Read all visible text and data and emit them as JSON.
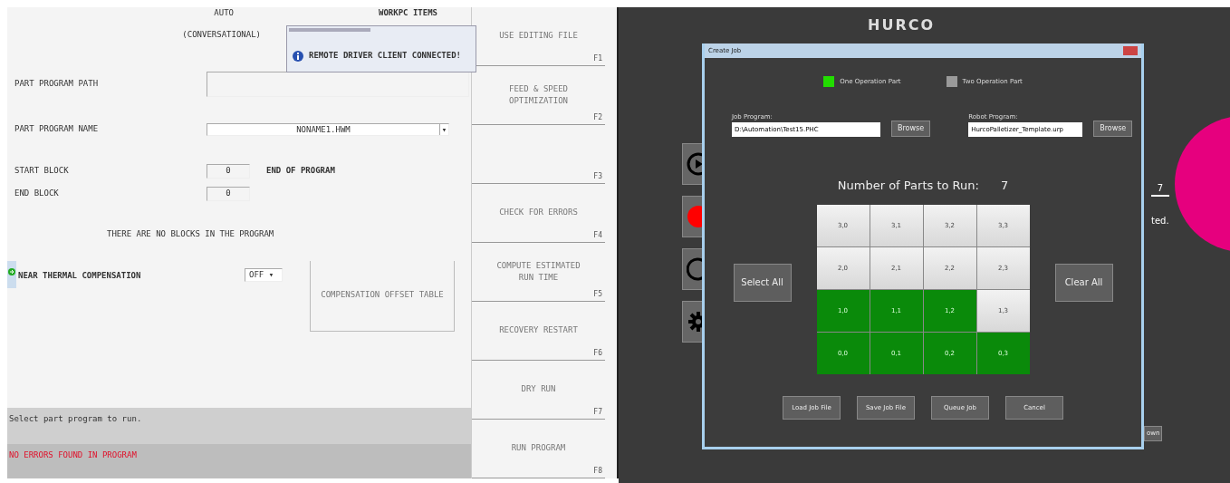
{
  "cnc_screen": {
    "mode": "AUTO",
    "mode_type": "(CONVERSATIONAL)",
    "header_right": "WORKPC ITEMS",
    "notification": {
      "message": "REMOTE DRIVER CLIENT CONNECTED!"
    },
    "fields": [
      {
        "kind": "text",
        "label": "PART PROGRAM PATH"
      },
      {
        "kind": "select",
        "label": "PART PROGRAM NAME",
        "value": "NONAME1.HWM",
        "arrow": "▾"
      }
    ],
    "start_block": {
      "label": "START BLOCK",
      "value": "0",
      "note": "END OF PROGRAM"
    },
    "end_block": {
      "label": "END BLOCK",
      "value": "0"
    },
    "blocks_message": "THERE ARE NO BLOCKS IN THE PROGRAM",
    "thermal": {
      "label": "NEAR THERMAL COMPENSATION",
      "value": "OFF",
      "arrow": "▾"
    },
    "offset_button": "COMPENSATION OFFSET TABLE",
    "softkeys": [
      {
        "label": "USE EDITING FILE",
        "key": "F1"
      },
      {
        "label": "FEED & SPEED OPTIMIZATION",
        "key": "F2"
      },
      {
        "key": "F3"
      },
      {
        "label": "CHECK FOR ERRORS",
        "key": "F4"
      },
      {
        "label": "COMPUTE ESTIMATED RUN TIME",
        "key": "F5"
      },
      {
        "label": "RECOVERY RESTART",
        "key": "F6"
      },
      {
        "label": "DRY RUN",
        "key": "F7"
      },
      {
        "label": "RUN PROGRAM",
        "key": "F8"
      }
    ],
    "prompt": "Select part program to run.",
    "error_line": "NO ERRORS FOUND IN PROGRAM"
  },
  "robot_app": {
    "logo": "HURCO",
    "count_field": "7",
    "status_fragment": "ted.",
    "button_fragment": "own",
    "dialog": {
      "title": "Create Job",
      "part_types": [
        {
          "label": "One Operation Part",
          "selected": true
        },
        {
          "label": "Two Operation Part",
          "selected": false
        }
      ],
      "job_program": {
        "label": "Job Program:",
        "value": "D:\\Automation\\Test15.PHC",
        "button": "Browse"
      },
      "robot_program": {
        "label": "Robot Program:",
        "value": "HurcoPalletizer_Template.urp",
        "button": "Browse"
      },
      "parts_label": "Number of Parts to Run:",
      "parts_count": "7",
      "select_all": "Select All",
      "clear_all": "Clear All",
      "cells": [
        {
          "label": "3,0",
          "selected": false
        },
        {
          "label": "3,1",
          "selected": false
        },
        {
          "label": "3,2",
          "selected": false
        },
        {
          "label": "3,3",
          "selected": false
        },
        {
          "label": "2,0",
          "selected": false
        },
        {
          "label": "2,1",
          "selected": false
        },
        {
          "label": "2,2",
          "selected": false
        },
        {
          "label": "2,3",
          "selected": false
        },
        {
          "label": "1,0",
          "selected": true
        },
        {
          "label": "1,1",
          "selected": true
        },
        {
          "label": "1,2",
          "selected": true
        },
        {
          "label": "1,3",
          "selected": false
        },
        {
          "label": "0,0",
          "selected": true
        },
        {
          "label": "0,1",
          "selected": true
        },
        {
          "label": "0,2",
          "selected": true
        },
        {
          "label": "0,3",
          "selected": true
        }
      ],
      "buttons": [
        "Load Job File",
        "Save Job File",
        "Queue Job",
        "Cancel"
      ]
    }
  }
}
